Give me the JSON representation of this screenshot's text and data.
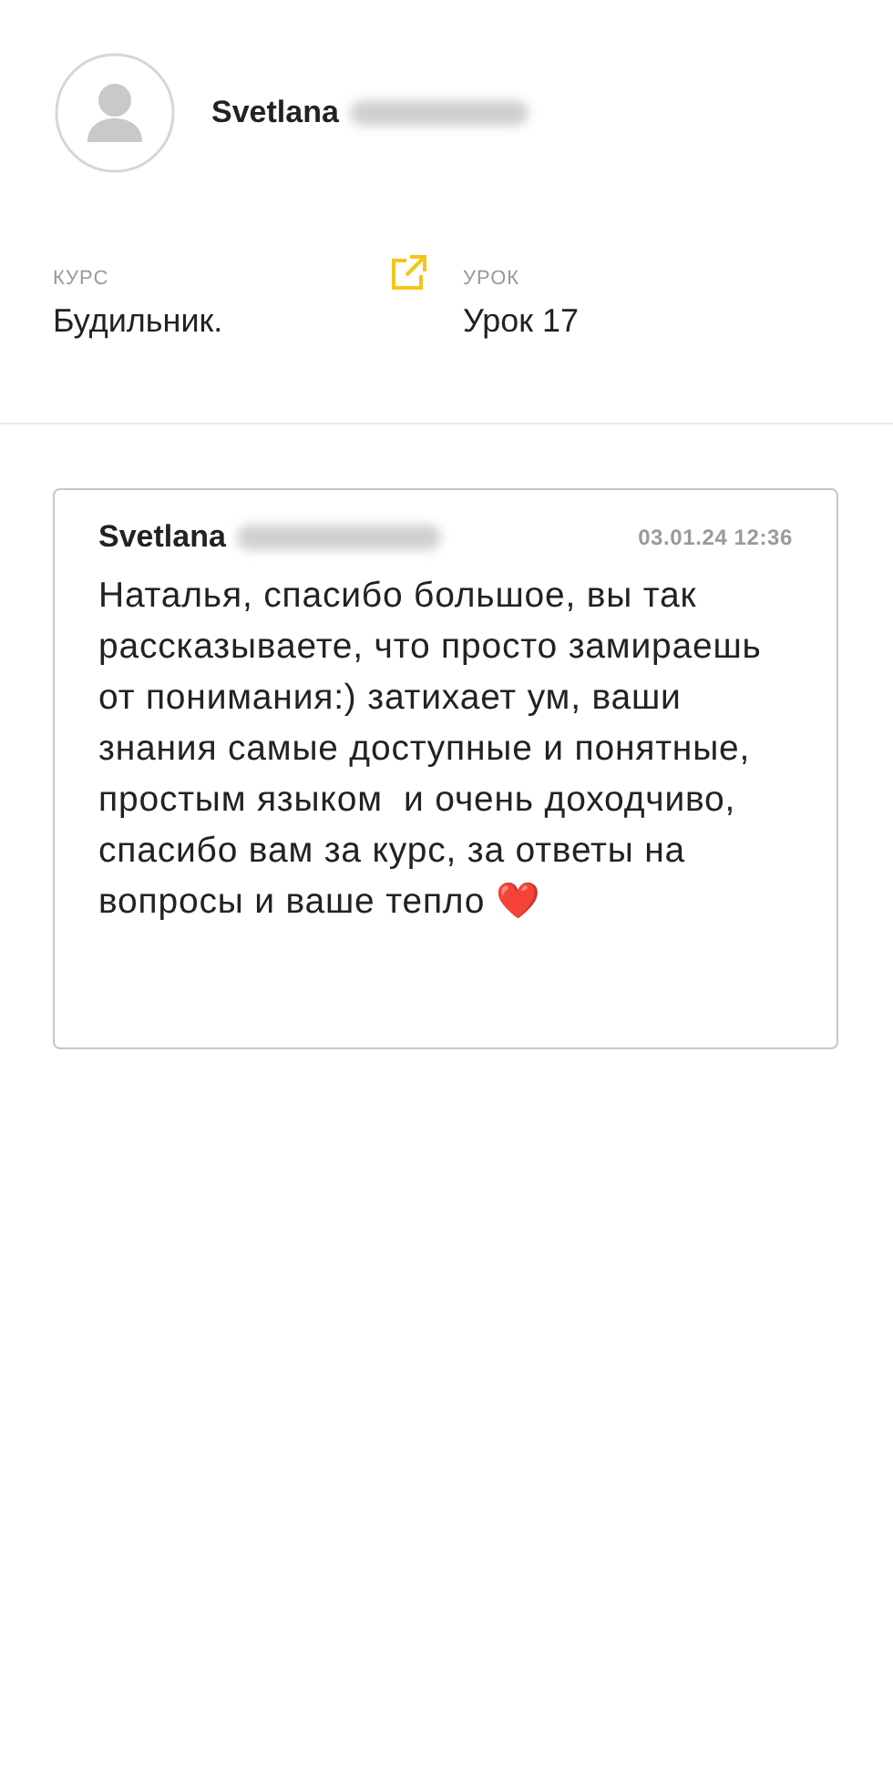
{
  "profile": {
    "name": "Svetlana",
    "surname_blurred": true
  },
  "info": [
    {
      "label": "КУРС",
      "value": "Будильник.",
      "link": true
    },
    {
      "label": "УРОК",
      "value": "Урок 17",
      "link": false
    }
  ],
  "comment": {
    "author": "Svetlana",
    "surname_blurred": true,
    "date": "03.01.24 12:36",
    "text": "Наталья, спасибо большое, вы так рассказываете, что просто замираешь от понимания:) затихает ум, ваши знания самые доступные и понятные, простым языком  и очень доходчиво, спасибо вам за курс, за ответы на вопросы и ваше тепло ❤️"
  }
}
